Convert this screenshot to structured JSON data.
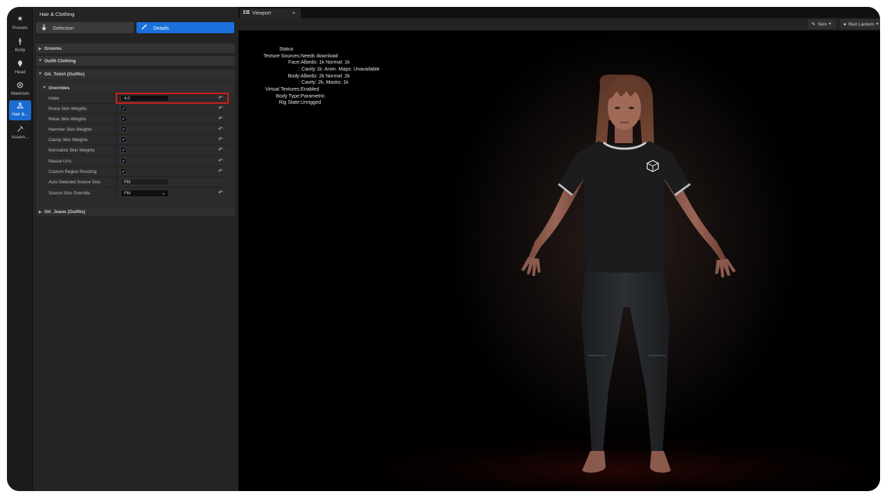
{
  "toolbar": {
    "items": [
      {
        "label": "Presets",
        "icon": "star-icon"
      },
      {
        "label": "Body",
        "icon": "body-icon"
      },
      {
        "label": "Head",
        "icon": "head-icon"
      },
      {
        "label": "Materials",
        "icon": "materials-icon"
      },
      {
        "label": "Hair &...",
        "icon": "hanger-icon",
        "active": true
      },
      {
        "label": "Assem...",
        "icon": "hammer-icon"
      }
    ]
  },
  "panel": {
    "title": "Hair & Clothing",
    "modes": {
      "selection": "Selection",
      "details": "Details",
      "active": "details"
    },
    "sections": {
      "grooms": "Grooms",
      "outfit_clothing": "Outfit Clothing",
      "tshirt": "OA_Tshirt (Outfits)",
      "overrides": "Overrides",
      "jeans": "OA_Jeans (Outfits)"
    },
    "properties": [
      {
        "name": "Index",
        "type": "number",
        "value": "4.0"
      },
      {
        "name": "Prune Skin Weights",
        "type": "checkbox",
        "checked": true
      },
      {
        "name": "Relax Skin Weights",
        "type": "checkbox",
        "checked": true
      },
      {
        "name": "Hammer Skin Weights",
        "type": "checkbox",
        "checked": true
      },
      {
        "name": "Clamp Skin Weights",
        "type": "checkbox",
        "checked": true
      },
      {
        "name": "Normalize Skin Weights",
        "type": "checkbox",
        "checked": true
      },
      {
        "name": "Resize UVs",
        "type": "checkbox",
        "checked": true
      },
      {
        "name": "Custom Region Resizing",
        "type": "checkbox",
        "checked": true
      },
      {
        "name": "Auto Selected Source Size",
        "type": "readonly",
        "value": "FM"
      },
      {
        "name": "Source Size Override",
        "type": "select",
        "value": "FM"
      }
    ],
    "highlight_color": "#d41e1e"
  },
  "viewport": {
    "tab_label": "Viewport",
    "skin_button": "Skin",
    "lighting_button": "Red Lantern",
    "status": {
      "heading": "Status",
      "rows": [
        {
          "key": "Texture Sources:",
          "value": "Needs download"
        },
        {
          "key": "Face:",
          "value": "Albedo: 1k Normal: 1k"
        },
        {
          "key": "",
          "value": ": Cavity 1k: Anim. Maps: Unavailable"
        },
        {
          "key": "Body:",
          "value": "Albedo: 2k Normal: 2k"
        },
        {
          "key": "",
          "value": ": Cavity: 2k, Masks: 1k"
        },
        {
          "key": "Virtual Textures:",
          "value": "Enabled"
        },
        {
          "key": "Body Type:",
          "value": "Parametric"
        },
        {
          "key": "Rig State:",
          "value": "Unrigged"
        }
      ]
    },
    "logo_icon": "cube-logo-icon"
  },
  "colors": {
    "accent": "#1a6fdc",
    "highlight": "#d41e1e",
    "shirt": "#1c1c1e",
    "jeans": "#2a2c2f"
  }
}
